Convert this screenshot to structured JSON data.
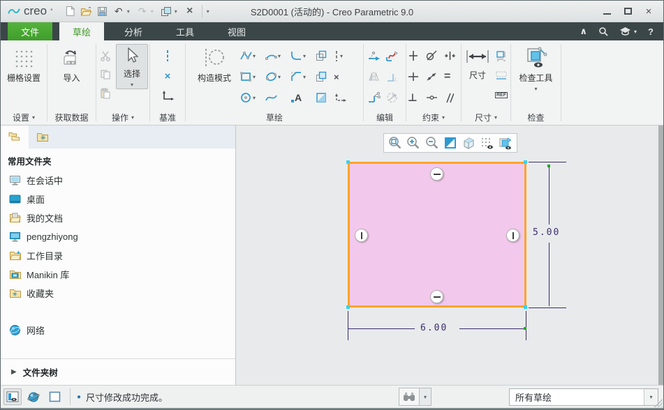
{
  "titlebar": {
    "brand": "creo",
    "brand_sup": "°",
    "title": "S2D0001 (活动的) - Creo Parametric 9.0"
  },
  "tabs": {
    "file": "文件",
    "sketch": "草绘",
    "analysis": "分析",
    "tools": "工具",
    "view": "视图"
  },
  "ribbon": {
    "settings": {
      "button": "栅格设置",
      "label": "设置"
    },
    "get_data": {
      "button": "导入",
      "label": "获取数据"
    },
    "operations": {
      "button": "选择",
      "label": "操作"
    },
    "datum": {
      "label": "基准"
    },
    "sketch": {
      "construction": "构造模式",
      "label": "草绘",
      "text_glyph": "A"
    },
    "edit": {
      "label": "编辑"
    },
    "constrain": {
      "label": "约束",
      "equal": "=",
      "perpendicular": "⊥"
    },
    "dimension": {
      "button": "尺寸",
      "label": "尺寸",
      "ref": "REF"
    },
    "inspect": {
      "button": "检查工具",
      "label": "检查"
    }
  },
  "sidebar": {
    "header": "常用文件夹",
    "items": [
      {
        "label": "在会话中",
        "icon": "monitor-session-icon"
      },
      {
        "label": "桌面",
        "icon": "desktop-icon"
      },
      {
        "label": "我的文档",
        "icon": "documents-folder-icon"
      },
      {
        "label": "pengzhiyong",
        "icon": "computer-icon"
      },
      {
        "label": "工作目录",
        "icon": "working-directory-icon"
      },
      {
        "label": "Manikin 库",
        "icon": "manikin-library-icon"
      },
      {
        "label": "收藏夹",
        "icon": "favorites-folder-icon"
      }
    ],
    "network": "网络",
    "folder_tree": "文件夹树"
  },
  "canvas": {
    "width_dim": "6.00",
    "height_dim": "5.00"
  },
  "statusbar": {
    "message": "尺寸修改成功完成。",
    "filter": "所有草绘"
  },
  "glyphs": {
    "caret": "▾",
    "undo": "↶",
    "redo": "↷",
    "close_small": "×",
    "chevron_up": "∧",
    "help": "?",
    "expand": "▶",
    "point": "×",
    "bullet": "●",
    "minimize_note": "",
    "text_tool": "A",
    "equal": "=",
    "perp": "⊥"
  },
  "colors": {
    "accent_green": "#3f9d2b",
    "ribbon_dark": "#3b4649",
    "sketch_fill": "#f2c9ec",
    "sketch_border": "#ffa427",
    "dimension": "#3c2c6e",
    "icon_blue": "#2e9ad2"
  }
}
